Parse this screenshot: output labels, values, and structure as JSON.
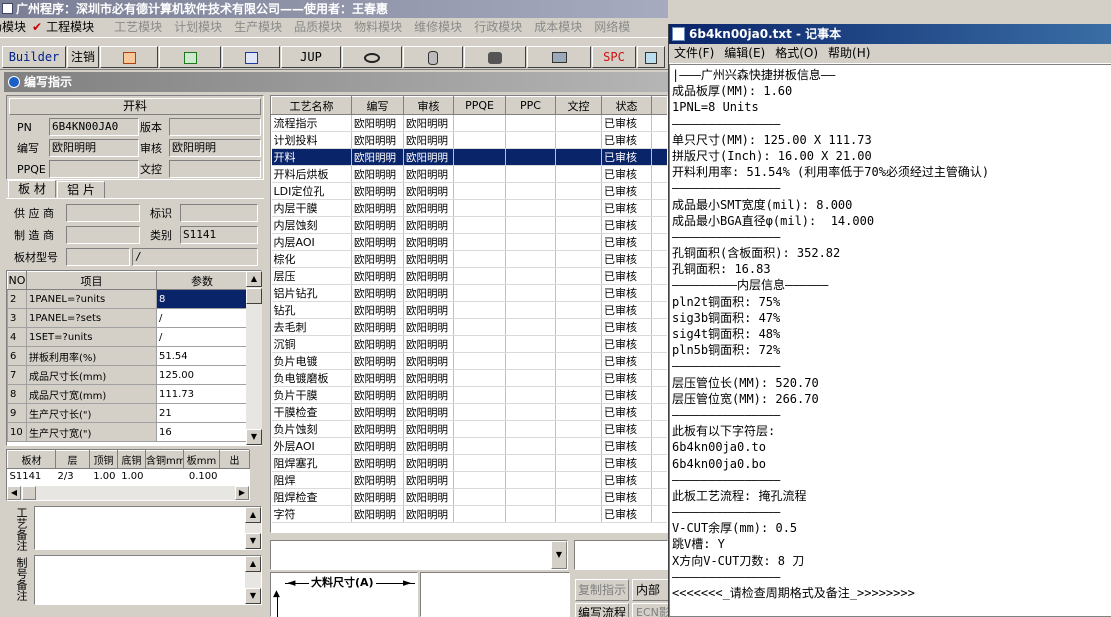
{
  "app": {
    "title": "广州程序：深圳市必有德计算机软件技术有限公司——使用者：王春惠",
    "menus": [
      {
        "label": "市场模块",
        "active": true
      },
      {
        "label": "工程模块",
        "active": true
      },
      {
        "label": "工艺模块",
        "active": false
      },
      {
        "label": "计划模块",
        "active": false
      },
      {
        "label": "生产模块",
        "active": false
      },
      {
        "label": "品质模块",
        "active": false
      },
      {
        "label": "物料模块",
        "active": false
      },
      {
        "label": "维修模块",
        "active": false
      },
      {
        "label": "行政模块",
        "active": false
      },
      {
        "label": "成本模块",
        "active": false
      },
      {
        "label": "网络模",
        "active": false
      }
    ],
    "toolbar": {
      "builder": "Builder",
      "logout": "注销",
      "jup": "JUP",
      "spc": "SPC"
    },
    "panel_title": "编写指示",
    "section_title": "开料",
    "fields": {
      "pn_label": "PN",
      "pn_value": "6B4KN00JA0",
      "version_label": "版本",
      "version_value": "",
      "writer_label": "编写",
      "writer_value": "欧阳明明",
      "reviewer_label": "审核",
      "reviewer_value": "欧阳明明",
      "ppqe_label": "PPQE",
      "ppqe_value": "",
      "doc_label": "文控",
      "doc_value": ""
    },
    "tabs": {
      "sheet": "板 材",
      "foil": "铝 片"
    },
    "material": {
      "supplier_label": "供 应 商",
      "supplier_value": "",
      "mark_label": "标识",
      "mark_value": "",
      "maker_label": "制 造 商",
      "maker_value": "",
      "category_label": "类别",
      "category_value": "S1141",
      "model_label": "板材型号",
      "model_value": "",
      "model_value2": "/"
    },
    "params": {
      "headers": [
        "NO",
        "项目",
        "参数"
      ],
      "rows": [
        {
          "no": "2",
          "item": "1PANEL=?units",
          "value": "8"
        },
        {
          "no": "3",
          "item": "1PANEL=?sets",
          "value": "/"
        },
        {
          "no": "4",
          "item": "1SET=?units",
          "value": "/"
        },
        {
          "no": "6",
          "item": "拼板利用率(%)",
          "value": "51.54"
        },
        {
          "no": "7",
          "item": "成品尺寸长(mm)",
          "value": "125.00"
        },
        {
          "no": "8",
          "item": "成品尺寸宽(mm)",
          "value": "111.73"
        },
        {
          "no": "9",
          "item": "生产尺寸长(\")",
          "value": "21"
        },
        {
          "no": "10",
          "item": "生产尺寸宽(\")",
          "value": "16"
        }
      ]
    },
    "sheet_table": {
      "headers": [
        "板材",
        "层",
        "顶铜",
        "底铜",
        "含铜mm",
        "板mm",
        "出"
      ],
      "row": [
        "S1141",
        "2/3",
        "1.00",
        "1.00",
        "",
        "0.100",
        ""
      ]
    },
    "process_notes_label": "工艺备注",
    "sample_notes_label": "制号备注",
    "process": {
      "headers": [
        "工艺名称",
        "编写",
        "审核",
        "PPQE",
        "PPC",
        "文控",
        "状态"
      ],
      "writer": "欧阳明明",
      "reviewer": "欧阳明明",
      "status": "已审核",
      "selected": 2,
      "rows": [
        "流程指示",
        "计划投料",
        "开料",
        "开料后烘板",
        "LDI定位孔",
        "内层干膜",
        "内层蚀刻",
        "内层AOI",
        "棕化",
        "层压",
        "铝片钻孔",
        "钻孔",
        "去毛刺",
        "沉铜",
        "负片电镀",
        "负电镀磨板",
        "负片干膜",
        "干膜检查",
        "负片蚀刻",
        "外层AOI",
        "阻焊塞孔",
        "阻焊",
        "阻焊检查",
        "字符"
      ]
    },
    "dimension_label": "大料尺寸(A)",
    "buttons": {
      "copy": "复制指示",
      "inner": "内部",
      "write_flow": "编写流程",
      "ecn": "ECN影"
    }
  },
  "notepad": {
    "title": "6b4kn00ja0.txt - 记事本",
    "menus": [
      "文件(F)",
      "编辑(E)",
      "格式(O)",
      "帮助(H)"
    ],
    "lines": [
      "|———广州兴森快捷拼板信息——",
      "成品板厚(MM): 1.60",
      "1PNL=8 Units",
      "———————————————",
      "单只尺寸(MM): 125.00 X 111.73",
      "拼版尺寸(Inch): 16.00 X 21.00",
      "开料利用率: 51.54% (利用率低于70%必须经过主管确认)",
      "———————————————",
      "成品最小SMT宽度(mil): 8.000",
      "成品最小BGA直径φ(mil):  14.000",
      "———————————————",
      "孔铜面积(含板面积): 352.82",
      "孔铜面积: 16.83",
      "—————————内层信息——————",
      "pln2t铜面积: 75%",
      "sig3b铜面积: 47%",
      "sig4t铜面积: 48%",
      "pln5b铜面积: 72%",
      "———————————————",
      "层压管位长(MM): 520.70",
      "层压管位宽(MM): 266.70",
      "———————————————",
      "此板有以下字符层:",
      "6b4kn00ja0.to",
      "6b4kn00ja0.bo",
      "———————————————",
      "此板工艺流程: 掩孔流程",
      "———————————————",
      "V-CUT余厚(mm): 0.5",
      "跳V槽: Y",
      "X方向V-CUT刀数: 8 刀",
      "———————————————",
      "<<<<<<<_请检查周期格式及备注_>>>>>>>>"
    ]
  }
}
